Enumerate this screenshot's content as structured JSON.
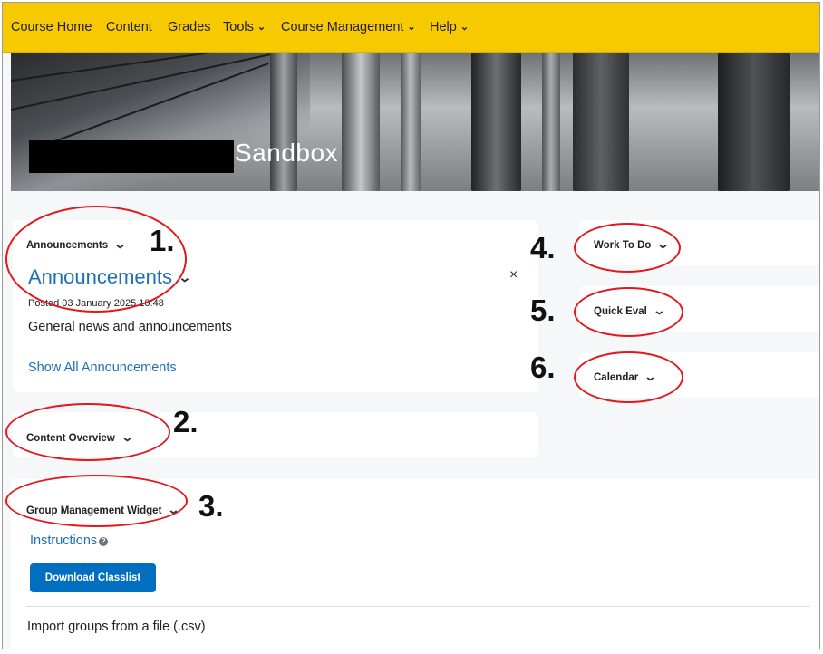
{
  "nav": {
    "items": [
      {
        "label": "Course Home",
        "has_menu": false
      },
      {
        "label": "Content",
        "has_menu": false
      },
      {
        "label": "Grades",
        "has_menu": false
      },
      {
        "label": "Tools",
        "has_menu": true
      },
      {
        "label": "Course Management",
        "has_menu": true
      },
      {
        "label": "Help",
        "has_menu": true
      }
    ],
    "chevron": "⌄",
    "bg_color": "#f7c900"
  },
  "banner": {
    "title": "Sandbox"
  },
  "announcements_widget": {
    "title": "Announcements",
    "heading": "Announcements",
    "posted": "Posted 03 January 2025 10:48",
    "body": "General news and announcements",
    "link": "Show All Announcements",
    "close": "×"
  },
  "content_overview_widget": {
    "title": "Content Overview"
  },
  "group_widget": {
    "title": "Group Management Widget",
    "instructions_link": "Instructions",
    "help_glyph": "?",
    "download_button": "Download Classlist",
    "import_text": "Import groups from a file (.csv)"
  },
  "work_to_do_widget": {
    "title": "Work To Do"
  },
  "quick_eval_widget": {
    "title": "Quick Eval"
  },
  "calendar_widget": {
    "title": "Calendar"
  },
  "annotations": {
    "markers": [
      "1.",
      "2.",
      "3.",
      "4.",
      "5.",
      "6."
    ],
    "ring_color": "#e0191e"
  },
  "colors": {
    "link": "#1d6fb8",
    "primary_button": "#006fbf"
  }
}
